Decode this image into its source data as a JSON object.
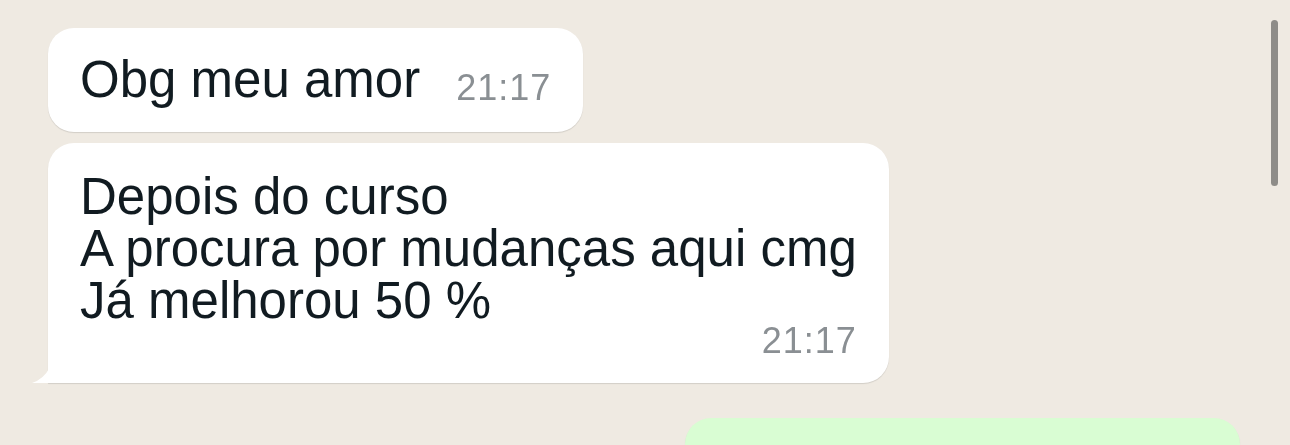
{
  "messages": [
    {
      "kind": "incoming",
      "tail": false,
      "lines": [
        "Obg meu amor"
      ],
      "time": "21:17"
    },
    {
      "kind": "incoming",
      "tail": true,
      "lines": [
        "Depois do curso",
        "A procura por mudanças aqui cmg",
        "Já melhorou 50 %"
      ],
      "time": "21:17"
    },
    {
      "kind": "outgoing"
    }
  ]
}
